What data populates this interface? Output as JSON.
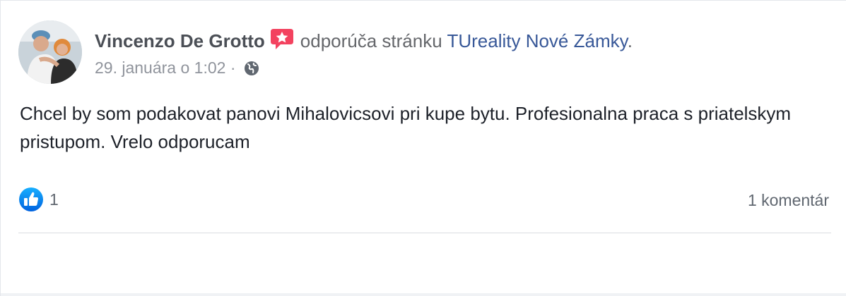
{
  "post": {
    "author": "Vincenzo De Grotto",
    "action_text": "odporúča stránku",
    "page_name": "TUreality Nové Zámky",
    "trailing_punct": ".",
    "timestamp": "29. januára o 1:02",
    "separator": "·",
    "privacy_icon": "globe-icon",
    "badge_icon": "recommendation-star-icon",
    "body": "Chcel by som podakovat panovi Mihalovicsovi pri kupe bytu. Profesionalna praca s priatelskym pristupom. Vrelo odporucam"
  },
  "footer": {
    "like_icon": "like-thumb-icon",
    "like_count": "1",
    "comments_label": "1 komentár"
  },
  "colors": {
    "author": "#4b4f56",
    "link": "#385898",
    "meta": "#90949c",
    "body": "#1d2129",
    "like_blue": "#1877f2",
    "badge_red": "#f3425f"
  }
}
